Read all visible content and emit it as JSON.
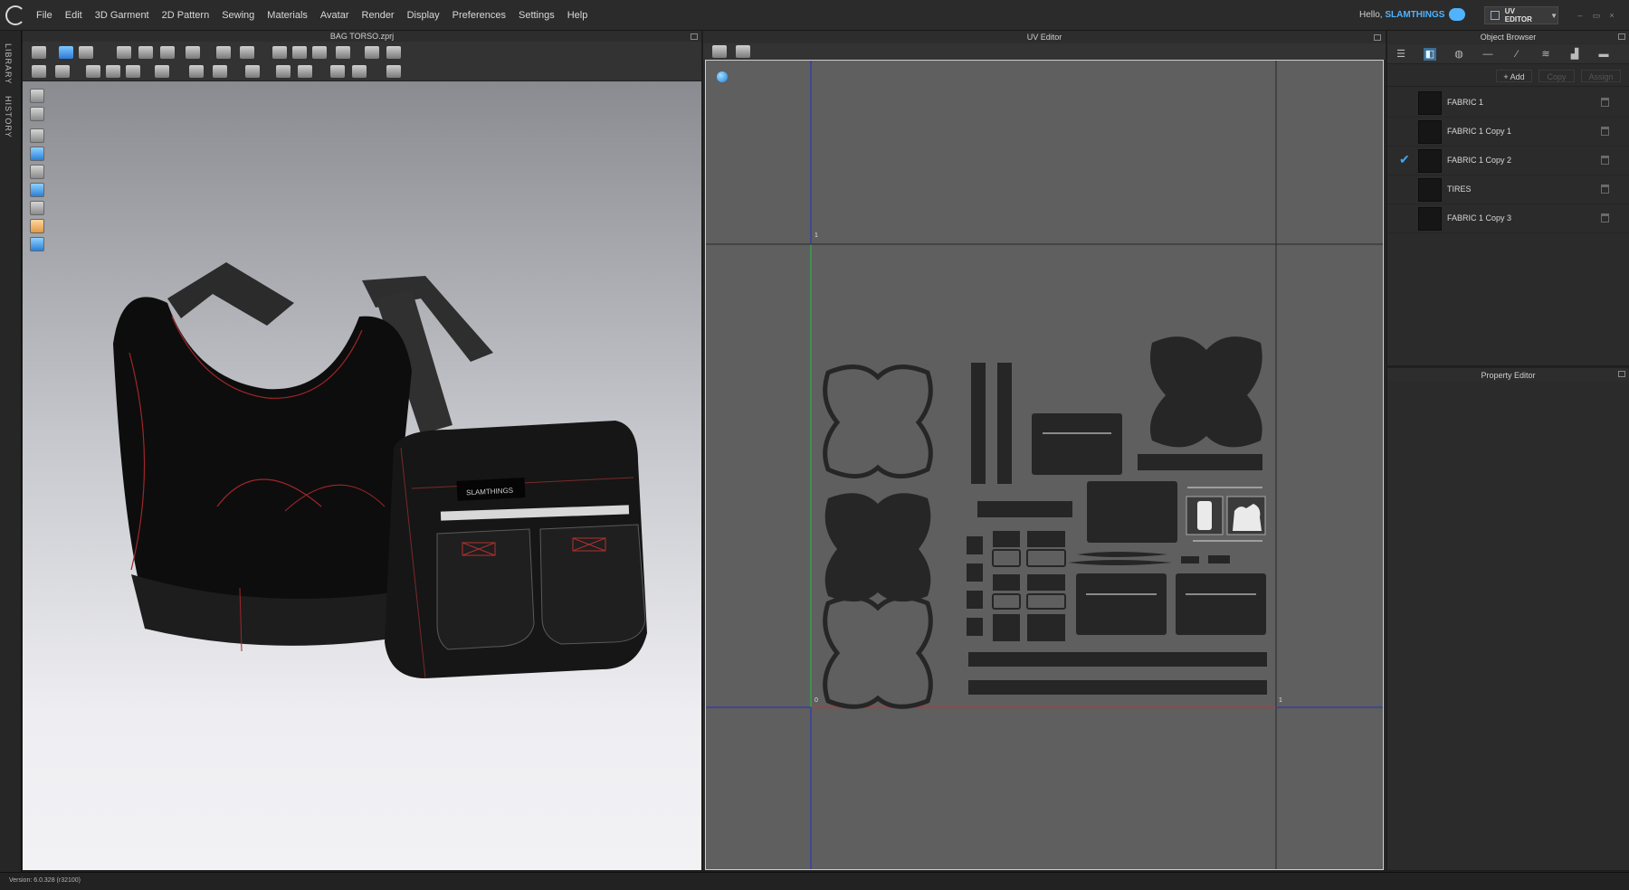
{
  "menubar": {
    "items": [
      "File",
      "Edit",
      "3D Garment",
      "2D Pattern",
      "Sewing",
      "Materials",
      "Avatar",
      "Render",
      "Display",
      "Preferences",
      "Settings",
      "Help"
    ],
    "greeting": "Hello,",
    "username": "SLAMTHINGS",
    "mode_label": "UV EDITOR"
  },
  "left_tabs": {
    "library": "LIBRARY",
    "history": "HISTORY"
  },
  "panel3d": {
    "title": "BAG TORSO.zprj",
    "bag_label": "SLAMTHINGS"
  },
  "uv_editor": {
    "title": "UV Editor",
    "ticks": {
      "top_left": "1",
      "bottom_left": "0",
      "bottom_right": "1"
    }
  },
  "object_browser": {
    "title": "Object Browser",
    "add_label": "+ Add",
    "copy_label": "Copy",
    "assign_label": "Assign",
    "fabrics": [
      {
        "name": "FABRIC 1",
        "checked": false
      },
      {
        "name": "FABRIC 1 Copy 1",
        "checked": false
      },
      {
        "name": "FABRIC 1 Copy 2",
        "checked": true
      },
      {
        "name": "TIRES",
        "checked": false
      },
      {
        "name": "FABRIC 1 Copy 3",
        "checked": false
      }
    ]
  },
  "property_editor": {
    "title": "Property Editor"
  },
  "status": {
    "version": "Version: 6.0.328 (r32100)"
  },
  "colors": {
    "accent": "#4fb3ff",
    "uv_bg": "#5f5f5f",
    "piece": "#262626",
    "seam": "#c0392b"
  }
}
